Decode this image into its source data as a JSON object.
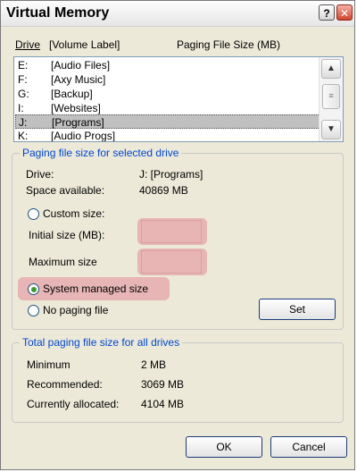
{
  "window": {
    "title": "Virtual Memory",
    "help_glyph": "?",
    "close_glyph": "✕"
  },
  "list": {
    "headers": {
      "drive": "Drive",
      "volume_label": "[Volume Label]",
      "paging_size": "Paging File Size (MB)"
    },
    "rows": [
      {
        "drive": "E:",
        "label": "[Audio Files]"
      },
      {
        "drive": "F:",
        "label": "[Axy Music]"
      },
      {
        "drive": "G:",
        "label": "[Backup]"
      },
      {
        "drive": "I:",
        "label": "[Websites]"
      },
      {
        "drive": "J:",
        "label": "[Programs]"
      },
      {
        "drive": "K:",
        "label": "[Audio Progs]"
      }
    ],
    "selected_index": 4
  },
  "selected_drive_group": {
    "title": "Paging file size for selected drive",
    "drive_label": "Drive:",
    "drive_value": "J:  [Programs]",
    "space_label": "Space available:",
    "space_value": "40869 MB",
    "custom_size_label": "Custom size:",
    "initial_size_label": "Initial size (MB):",
    "maximum_size_label": "Maximum size",
    "system_managed_label": "System managed size",
    "no_paging_label": "No paging file",
    "set_button": "Set",
    "selected_option": "system_managed"
  },
  "totals_group": {
    "title": "Total paging file size for all drives",
    "minimum_label": "Minimum",
    "minimum_value": "2 MB",
    "recommended_label": "Recommended:",
    "recommended_value": "3069 MB",
    "allocated_label": "Currently allocated:",
    "allocated_value": "4104 MB"
  },
  "buttons": {
    "ok": "OK",
    "cancel": "Cancel"
  },
  "colors": {
    "group_title": "#0046d5",
    "highlight": "#e7b5b5",
    "dialog_bg": "#ece9d8"
  }
}
